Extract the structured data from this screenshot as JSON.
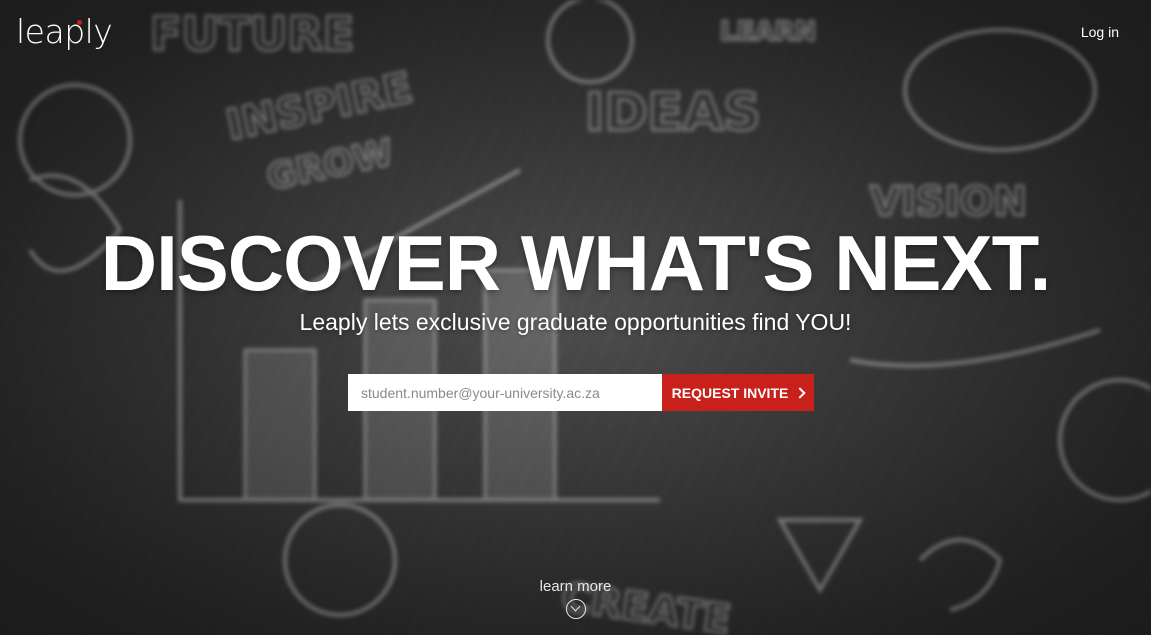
{
  "brand": {
    "logo_text": "leaply",
    "accent_color": "#c8201a"
  },
  "nav": {
    "login_label": "Log in"
  },
  "hero": {
    "headline": "DISCOVER WHAT'S NEXT.",
    "subheadline": "Leaply lets exclusive graduate opportunities find YOU!",
    "background": "blurred-chalkboard-image"
  },
  "invite_form": {
    "email_placeholder": "student.number@your-university.ac.za",
    "email_value": "",
    "button_label": "REQUEST INVITE",
    "button_icon": "chevron-right-icon"
  },
  "footer": {
    "learn_more_label": "learn more",
    "learn_more_icon": "circle-chevron-down-icon"
  }
}
